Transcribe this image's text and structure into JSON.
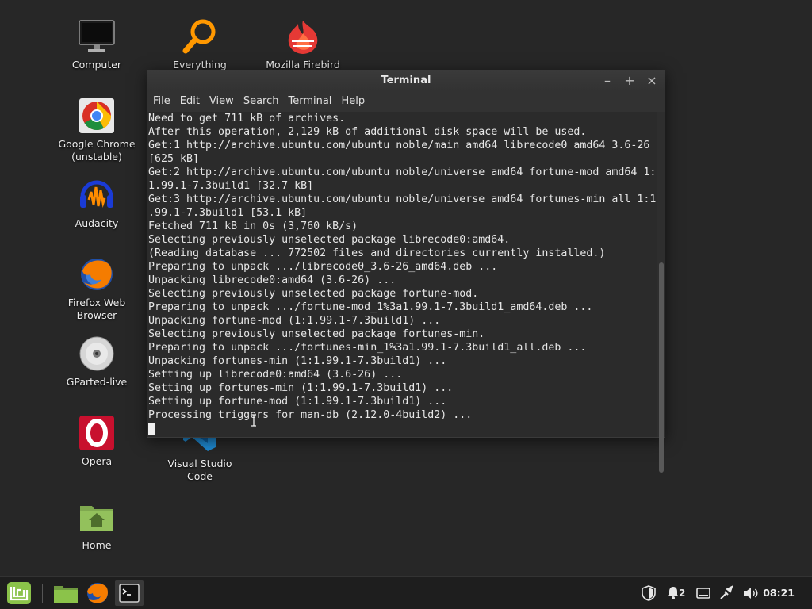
{
  "desktop": {
    "icons": [
      {
        "label": "Computer"
      },
      {
        "label": "Everything"
      },
      {
        "label": "Mozilla Firebird"
      },
      {
        "label": "Google Chrome (unstable)"
      },
      {
        "label": "Audacity"
      },
      {
        "label": "Firefox Web Browser"
      },
      {
        "label": "GParted-live"
      },
      {
        "label": "Opera"
      },
      {
        "label": "Visual Studio Code"
      },
      {
        "label": "Home"
      }
    ]
  },
  "terminal": {
    "title": "Terminal",
    "menu": [
      "File",
      "Edit",
      "View",
      "Search",
      "Terminal",
      "Help"
    ],
    "lines": [
      "Need to get 711 kB of archives.",
      "After this operation, 2,129 kB of additional disk space will be used.",
      "Get:1 http://archive.ubuntu.com/ubuntu noble/main amd64 librecode0 amd64 3.6-26",
      "[625 kB]",
      "Get:2 http://archive.ubuntu.com/ubuntu noble/universe amd64 fortune-mod amd64 1:",
      "1.99.1-7.3build1 [32.7 kB]",
      "Get:3 http://archive.ubuntu.com/ubuntu noble/universe amd64 fortunes-min all 1:1",
      ".99.1-7.3build1 [53.1 kB]",
      "Fetched 711 kB in 0s (3,760 kB/s)",
      "Selecting previously unselected package librecode0:amd64.",
      "(Reading database ... 772502 files and directories currently installed.)",
      "Preparing to unpack .../librecode0_3.6-26_amd64.deb ...",
      "Unpacking librecode0:amd64 (3.6-26) ...",
      "Selecting previously unselected package fortune-mod.",
      "Preparing to unpack .../fortune-mod_1%3a1.99.1-7.3build1_amd64.deb ...",
      "Unpacking fortune-mod (1:1.99.1-7.3build1) ...",
      "Selecting previously unselected package fortunes-min.",
      "Preparing to unpack .../fortunes-min_1%3a1.99.1-7.3build1_all.deb ...",
      "Unpacking fortunes-min (1:1.99.1-7.3build1) ...",
      "Setting up librecode0:amd64 (3.6-26) ...",
      "Setting up fortunes-min (1:1.99.1-7.3build1) ...",
      "Setting up fortune-mod (1:1.99.1-7.3build1) ...",
      "Processing triggers for man-db (2.12.0-4build2) ..."
    ]
  },
  "tray": {
    "notifications_count": "2",
    "clock": "08:21"
  },
  "colors": {
    "desktop_bg": "#272727",
    "terminal_bg": "#2b2b2b",
    "mint_green": "#8bc34a"
  }
}
